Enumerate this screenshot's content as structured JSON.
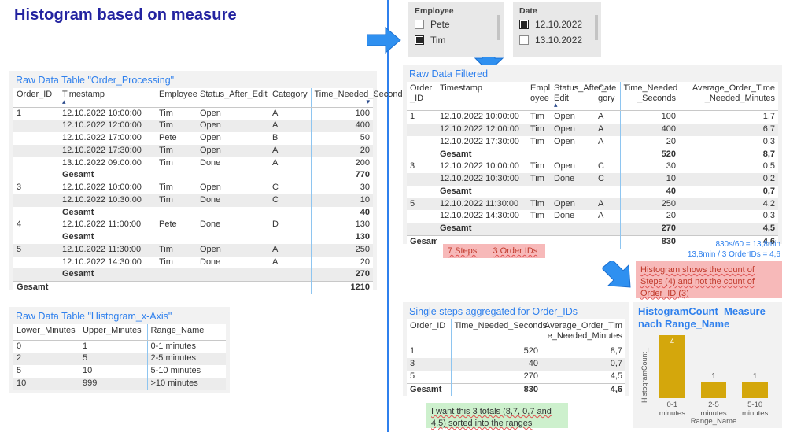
{
  "page": {
    "title": "Histogram based on measure"
  },
  "slicers": [
    {
      "name": "employee",
      "title": "Employee",
      "items": [
        {
          "label": "Pete",
          "checked": false
        },
        {
          "label": "Tim",
          "checked": true
        }
      ]
    },
    {
      "name": "date",
      "title": "Date",
      "items": [
        {
          "label": "12.10.2022",
          "checked": true
        },
        {
          "label": "13.10.2022",
          "checked": false
        }
      ]
    }
  ],
  "raw_table": {
    "title": "Raw Data Table \"Order_Processing\"",
    "columns": [
      "Order_ID",
      "Timestamp",
      "Employee",
      "Status_After_Edit",
      "Category",
      "Time_Needed_Seconds"
    ],
    "sort": {
      "Timestamp": "asc",
      "Time_Needed_Seconds": "desc"
    },
    "rows": [
      {
        "kind": "data",
        "cells": [
          "1",
          "12.10.2022 10:00:00",
          "Tim",
          "Open",
          "A",
          "100"
        ]
      },
      {
        "kind": "alt",
        "cells": [
          "",
          "12.10.2022 12:00:00",
          "Tim",
          "Open",
          "A",
          "400"
        ]
      },
      {
        "kind": "data",
        "cells": [
          "",
          "12.10.2022 17:00:00",
          "Pete",
          "Open",
          "B",
          "50"
        ]
      },
      {
        "kind": "alt",
        "cells": [
          "",
          "12.10.2022 17:30:00",
          "Tim",
          "Open",
          "A",
          "20"
        ]
      },
      {
        "kind": "data",
        "cells": [
          "",
          "13.10.2022 09:00:00",
          "Tim",
          "Done",
          "A",
          "200"
        ]
      },
      {
        "kind": "total",
        "cells": [
          "",
          "Gesamt",
          "",
          "",
          "",
          "770"
        ]
      },
      {
        "kind": "data",
        "cells": [
          "3",
          "12.10.2022 10:00:00",
          "Tim",
          "Open",
          "C",
          "30"
        ]
      },
      {
        "kind": "alt",
        "cells": [
          "",
          "12.10.2022 10:30:00",
          "Tim",
          "Done",
          "C",
          "10"
        ]
      },
      {
        "kind": "total",
        "cells": [
          "",
          "Gesamt",
          "",
          "",
          "",
          "40"
        ]
      },
      {
        "kind": "data",
        "cells": [
          "4",
          "12.10.2022 11:00:00",
          "Pete",
          "Done",
          "D",
          "130"
        ]
      },
      {
        "kind": "total",
        "cells": [
          "",
          "Gesamt",
          "",
          "",
          "",
          "130"
        ]
      },
      {
        "kind": "alt",
        "cells": [
          "5",
          "12.10.2022 11:30:00",
          "Tim",
          "Open",
          "A",
          "250"
        ]
      },
      {
        "kind": "data",
        "cells": [
          "",
          "12.10.2022 14:30:00",
          "Tim",
          "Done",
          "A",
          "20"
        ]
      },
      {
        "kind": "total-alt",
        "cells": [
          "",
          "Gesamt",
          "",
          "",
          "",
          "270"
        ]
      },
      {
        "kind": "grand",
        "cells": [
          "Gesamt",
          "",
          "",
          "",
          "",
          "1210"
        ]
      }
    ]
  },
  "xaxis_table": {
    "title": "Raw Data Table \"Histogram_x-Axis\"",
    "columns": [
      "Lower_Minutes",
      "Upper_Minutes",
      "Range_Name"
    ],
    "rows": [
      {
        "kind": "data",
        "cells": [
          "0",
          "1",
          "0-1 minutes"
        ]
      },
      {
        "kind": "alt",
        "cells": [
          "2",
          "5",
          "2-5 minutes"
        ]
      },
      {
        "kind": "data",
        "cells": [
          "5",
          "10",
          "5-10 minutes"
        ]
      },
      {
        "kind": "alt",
        "cells": [
          "10",
          "999",
          ">10 minutes"
        ]
      }
    ]
  },
  "filtered_table": {
    "title": "Raw Data Filtered",
    "columns": [
      "Order\n_ID",
      "Timestamp",
      "Empl\noyee",
      "Status_After_\nEdit",
      "Cate\ngory",
      "Time_Needed\n_Seconds",
      "Average_Order_Time\n_Needed_Minutes"
    ],
    "sort": {
      "Status_After_Edit": "asc"
    },
    "rows": [
      {
        "kind": "data",
        "cells": [
          "1",
          "12.10.2022 10:00:00",
          "Tim",
          "Open",
          "A",
          "100",
          "1,7"
        ]
      },
      {
        "kind": "alt",
        "cells": [
          "",
          "12.10.2022 12:00:00",
          "Tim",
          "Open",
          "A",
          "400",
          "6,7"
        ]
      },
      {
        "kind": "data",
        "cells": [
          "",
          "12.10.2022 17:30:00",
          "Tim",
          "Open",
          "A",
          "20",
          "0,3"
        ]
      },
      {
        "kind": "total",
        "cells": [
          "",
          "Gesamt",
          "",
          "",
          "",
          "520",
          "8,7"
        ]
      },
      {
        "kind": "data",
        "cells": [
          "3",
          "12.10.2022 10:00:00",
          "Tim",
          "Open",
          "C",
          "30",
          "0,5"
        ]
      },
      {
        "kind": "alt",
        "cells": [
          "",
          "12.10.2022 10:30:00",
          "Tim",
          "Done",
          "C",
          "10",
          "0,2"
        ]
      },
      {
        "kind": "total",
        "cells": [
          "",
          "Gesamt",
          "",
          "",
          "",
          "40",
          "0,7"
        ]
      },
      {
        "kind": "alt",
        "cells": [
          "5",
          "12.10.2022 11:30:00",
          "Tim",
          "Open",
          "A",
          "250",
          "4,2"
        ]
      },
      {
        "kind": "data",
        "cells": [
          "",
          "12.10.2022 14:30:00",
          "Tim",
          "Done",
          "A",
          "20",
          "0,3"
        ]
      },
      {
        "kind": "total-alt",
        "cells": [
          "",
          "Gesamt",
          "",
          "",
          "",
          "270",
          "4,5"
        ]
      },
      {
        "kind": "grand",
        "cells": [
          "Gesamt",
          "",
          "",
          "",
          "",
          "830",
          "4,6"
        ]
      }
    ]
  },
  "aggregated_table": {
    "title": "Single steps aggregated for Order_IDs",
    "columns": [
      "Order_ID",
      "Time_Needed_Seconds",
      "Average_Order_Tim\ne_Needed_Minutes"
    ],
    "rows": [
      {
        "kind": "data",
        "cells": [
          "1",
          "520",
          "8,7"
        ]
      },
      {
        "kind": "alt",
        "cells": [
          "3",
          "40",
          "0,7"
        ]
      },
      {
        "kind": "data",
        "cells": [
          "5",
          "270",
          "4,5"
        ]
      },
      {
        "kind": "grand",
        "cells": [
          "Gesamt",
          "830",
          "4,6"
        ]
      }
    ]
  },
  "callouts": {
    "steps_orders": {
      "part1": "7 Steps",
      "part2": "3 Order IDs"
    },
    "calc_line1": "830s/60 = 13,8min",
    "calc_line2": "13,8min / 3 OrderIDs = 4,6",
    "histogram_note": "Histogram shows the count of Steps (4) and not the count of Order_ID (3)",
    "want_note": "I want this 3 totals (8,7, 0,7 and 4,5) sorted into the ranges"
  },
  "chart_data": {
    "type": "bar",
    "title": "HistogramCount_Measure nach Range_Name",
    "categories": [
      "0-1 minutes",
      "2-5 minutes",
      "5-10 minutes"
    ],
    "values": [
      4,
      1,
      1
    ],
    "xlabel": "Range_Name",
    "ylabel": "HistogramCount_",
    "ylim": [
      0,
      4
    ],
    "grid": false,
    "legend": "none",
    "color": "#d4a70c"
  },
  "colors": {
    "accent_blue": "#2f80ed",
    "title_blue": "#2323a0",
    "bar_gold": "#d4a70c",
    "callout_red_bg": "#f7b9b9",
    "callout_green_bg": "#cdf0cd"
  }
}
